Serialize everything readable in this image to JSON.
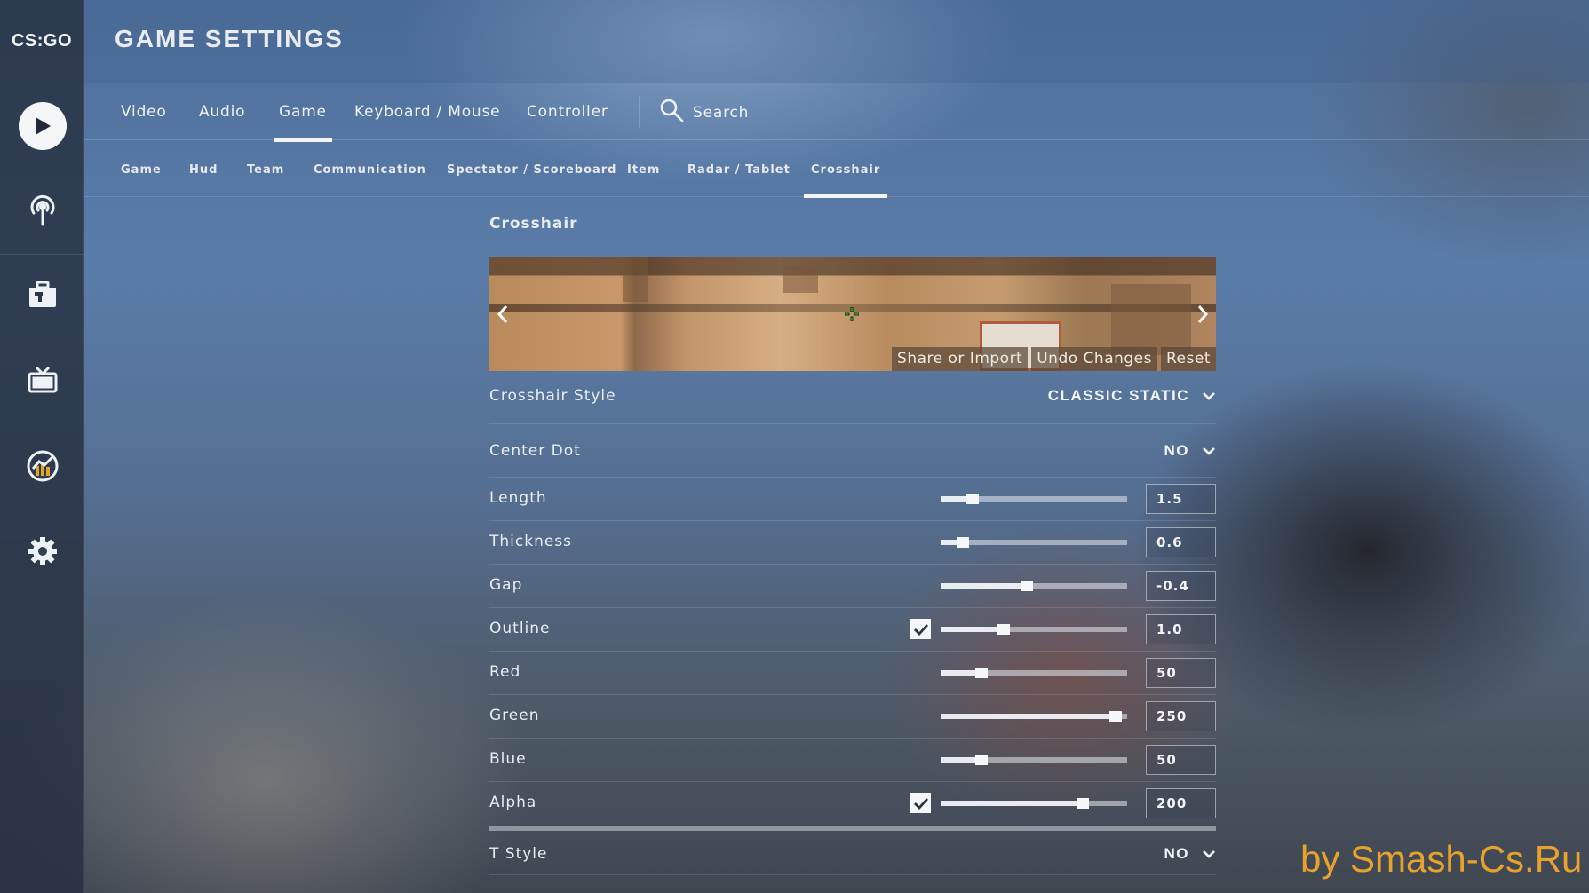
{
  "app": {
    "logo_text": "CS:GO"
  },
  "header": {
    "title": "GAME SETTINGS"
  },
  "tabs": [
    {
      "label": "Video"
    },
    {
      "label": "Audio"
    },
    {
      "label": "Game",
      "active": true
    },
    {
      "label": "Keyboard / Mouse"
    },
    {
      "label": "Controller"
    }
  ],
  "search": {
    "label": "Search",
    "icon": "search-icon"
  },
  "subtabs": [
    {
      "label": "Game"
    },
    {
      "label": "Hud"
    },
    {
      "label": "Team"
    },
    {
      "label": "Communication"
    },
    {
      "label": "Spectator / Scoreboard"
    },
    {
      "label": "Item"
    },
    {
      "label": "Radar / Tablet"
    },
    {
      "label": "Crosshair",
      "active": true
    }
  ],
  "sidebar": {
    "icons": [
      "play-icon",
      "broadcast-icon",
      "inventory-icon",
      "watch-tv-icon",
      "stats-icon",
      "settings-gear-icon"
    ]
  },
  "panel": {
    "section_title": "Crosshair",
    "preview": {
      "actions": {
        "share": "Share or Import",
        "undo": "Undo Changes",
        "reset": "Reset"
      },
      "crosshair_color": "#32fa32"
    },
    "crosshair_style": {
      "label": "Crosshair Style",
      "value": "CLASSIC STATIC"
    },
    "center_dot": {
      "label": "Center Dot",
      "value": "NO"
    },
    "length": {
      "label": "Length",
      "value": "1.5",
      "slider_fraction": 0.17
    },
    "thickness": {
      "label": "Thickness",
      "value": "0.6",
      "slider_fraction": 0.12
    },
    "gap": {
      "label": "Gap",
      "value": "-0.4",
      "slider_fraction": 0.46
    },
    "outline": {
      "label": "Outline",
      "value": "1.0",
      "slider_fraction": 0.34,
      "checked": true
    },
    "red": {
      "label": "Red",
      "value": "50",
      "slider_fraction": 0.22
    },
    "green": {
      "label": "Green",
      "value": "250",
      "slider_fraction": 0.94
    },
    "blue": {
      "label": "Blue",
      "value": "50",
      "slider_fraction": 0.22
    },
    "alpha": {
      "label": "Alpha",
      "value": "200",
      "slider_fraction": 0.76,
      "checked": true
    },
    "t_style": {
      "label": "T Style",
      "value": "NO"
    }
  },
  "watermark": {
    "text": "by Smash-Cs.Ru"
  }
}
